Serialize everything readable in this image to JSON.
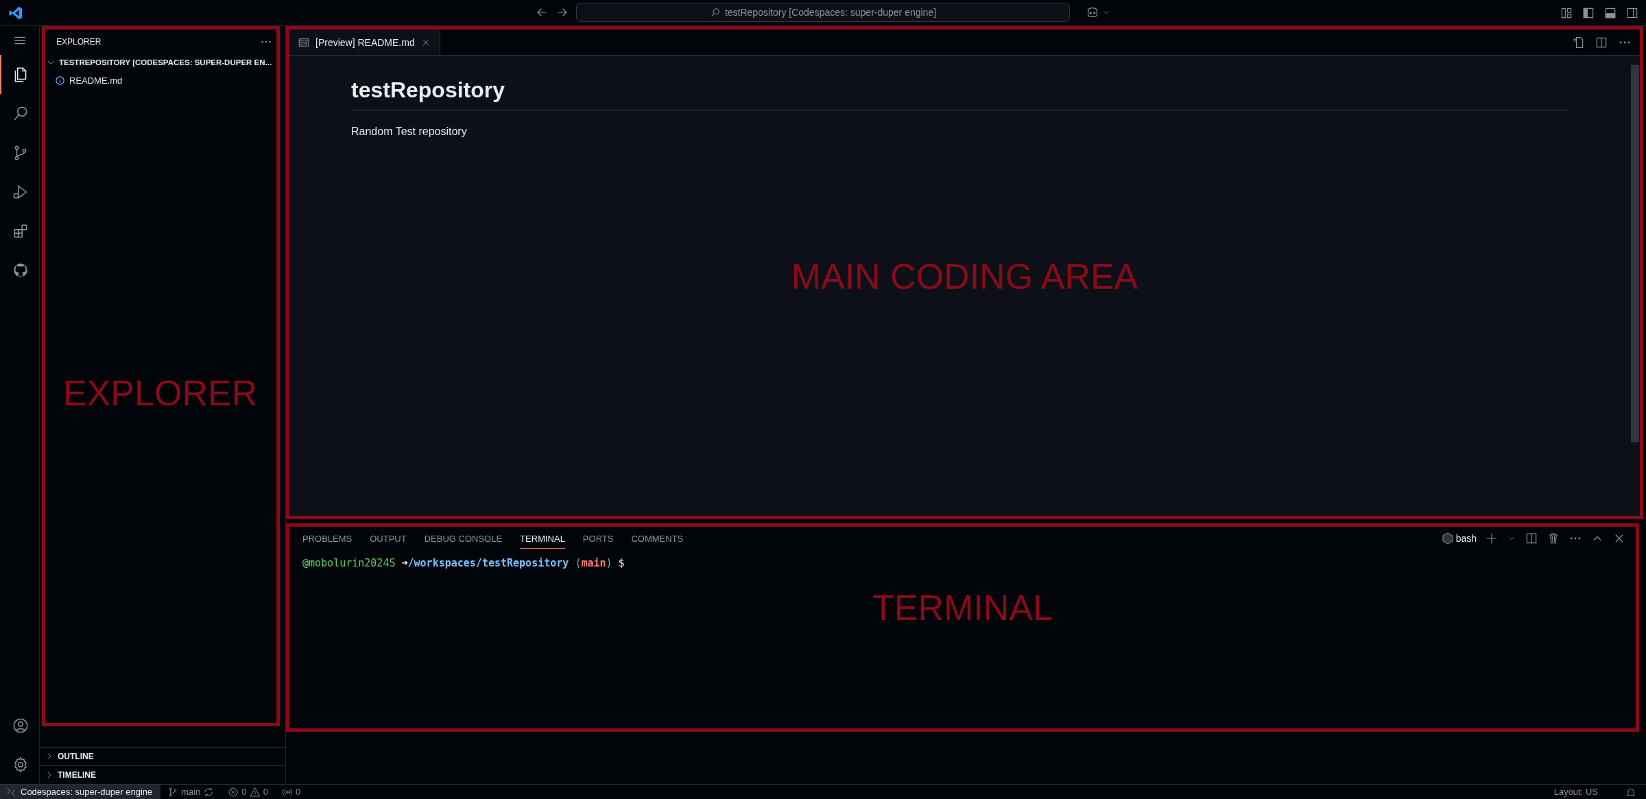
{
  "title_bar": {
    "search": "testRepository [Codespaces: super-duper engine]"
  },
  "activity_bar": {
    "items": [
      {
        "kind": "files",
        "selected": true
      },
      {
        "kind": "search",
        "selected": false
      },
      {
        "kind": "source-control",
        "selected": false
      },
      {
        "kind": "run-debug",
        "selected": false
      },
      {
        "kind": "extensions",
        "selected": false
      },
      {
        "kind": "github",
        "selected": false
      }
    ],
    "bottom": [
      {
        "kind": "account"
      },
      {
        "kind": "settings"
      }
    ]
  },
  "sidebar": {
    "annotation": "EXPLORER",
    "title": "EXPLORER",
    "folder": {
      "label": "TESTREPOSITORY [CODESPACES: SUPER-DUPER EN...",
      "expanded": true,
      "children": [
        {
          "label": "README.md"
        }
      ]
    },
    "sections": [
      {
        "label": "OUTLINE",
        "expanded": false
      },
      {
        "label": "TIMELINE",
        "expanded": false
      }
    ]
  },
  "editor": {
    "annotation": "MAIN CODING AREA",
    "tabs": [
      {
        "label": "[Preview] README.md",
        "selected": true
      }
    ],
    "preview": {
      "heading": "testRepository",
      "paragraph": "Random Test repository"
    }
  },
  "panel": {
    "annotation": "TERMINAL",
    "tabs": [
      {
        "label": "PROBLEMS",
        "selected": false
      },
      {
        "label": "OUTPUT",
        "selected": false
      },
      {
        "label": "DEBUG CONSOLE",
        "selected": false
      },
      {
        "label": "TERMINAL",
        "selected": true
      },
      {
        "label": "PORTS",
        "selected": false
      },
      {
        "label": "COMMENTS",
        "selected": false
      }
    ],
    "shell": "bash",
    "prompt": {
      "user": "@mobolurin2024S",
      "arrow": "➜",
      "path": "/workspaces/testRepository",
      "branch_open": "(",
      "branch": "main",
      "branch_close": ")",
      "symbol": "$"
    }
  },
  "status_bar": {
    "remote": "Codespaces: super-duper engine",
    "branch": "main",
    "errors": "0",
    "warnings": "0",
    "ports": "0",
    "layout": "Layout: US"
  }
}
